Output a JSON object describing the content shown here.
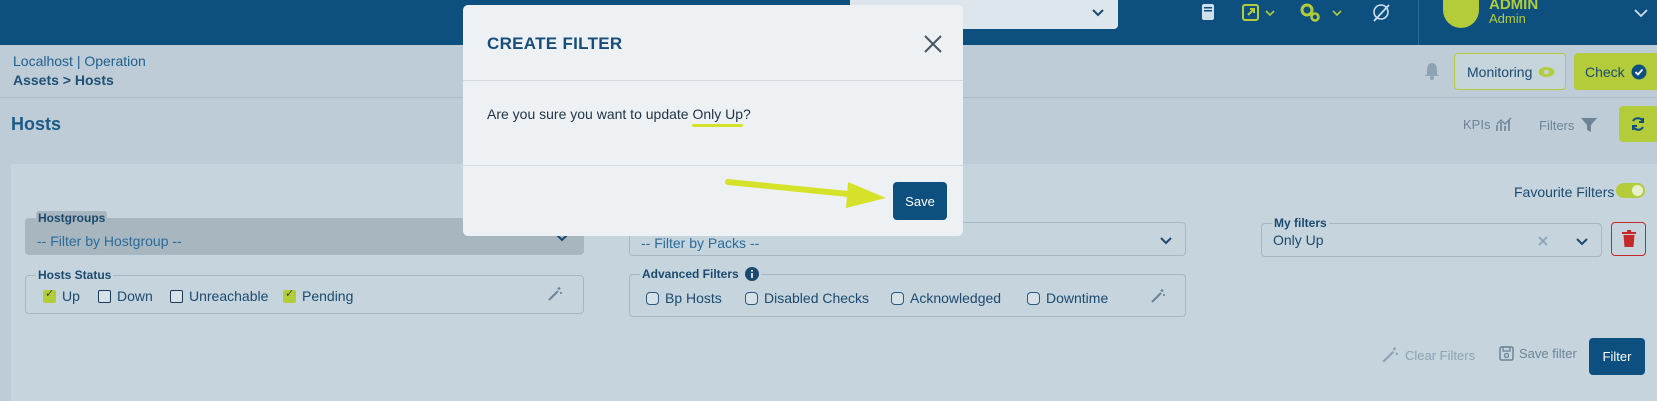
{
  "topbar": {
    "user_name": "ADMIN",
    "user_role": "Admin"
  },
  "breadcrumb": {
    "context": "Localhost | Operation",
    "path": "Assets > Hosts"
  },
  "header_actions": {
    "monitoring_label": "Monitoring",
    "check_label": "Check"
  },
  "page": {
    "title": "Hosts",
    "kpis_label": "KPIs",
    "filters_label": "Filters"
  },
  "panel": {
    "favourite_filters_label": "Favourite Filters",
    "hostgroups": {
      "legend": "Hostgroups",
      "placeholder": "-- Filter by Hostgroup --"
    },
    "packs": {
      "placeholder": "-- Filter by Packs --"
    },
    "my_filters": {
      "legend": "My filters",
      "value": "Only Up"
    },
    "hosts_status": {
      "legend": "Hosts Status",
      "options": [
        {
          "label": "Up",
          "checked": true
        },
        {
          "label": "Down",
          "checked": false
        },
        {
          "label": "Unreachable",
          "checked": false
        },
        {
          "label": "Pending",
          "checked": true
        }
      ]
    },
    "advanced_filters": {
      "legend": "Advanced Filters",
      "options": [
        {
          "label": "Bp Hosts"
        },
        {
          "label": "Disabled Checks"
        },
        {
          "label": "Acknowledged"
        },
        {
          "label": "Downtime"
        }
      ]
    },
    "clear_filters_label": "Clear Filters",
    "save_filter_label": "Save filter",
    "filter_button_label": "Filter"
  },
  "modal": {
    "title": "CREATE FILTER",
    "message_prefix": "Are you sure you want to update ",
    "message_highlight": "Only Up",
    "message_suffix": "?",
    "save_label": "Save"
  },
  "colors": {
    "brand": "#0d4f7e",
    "accent": "#b4cc3a",
    "danger": "#c62828"
  }
}
